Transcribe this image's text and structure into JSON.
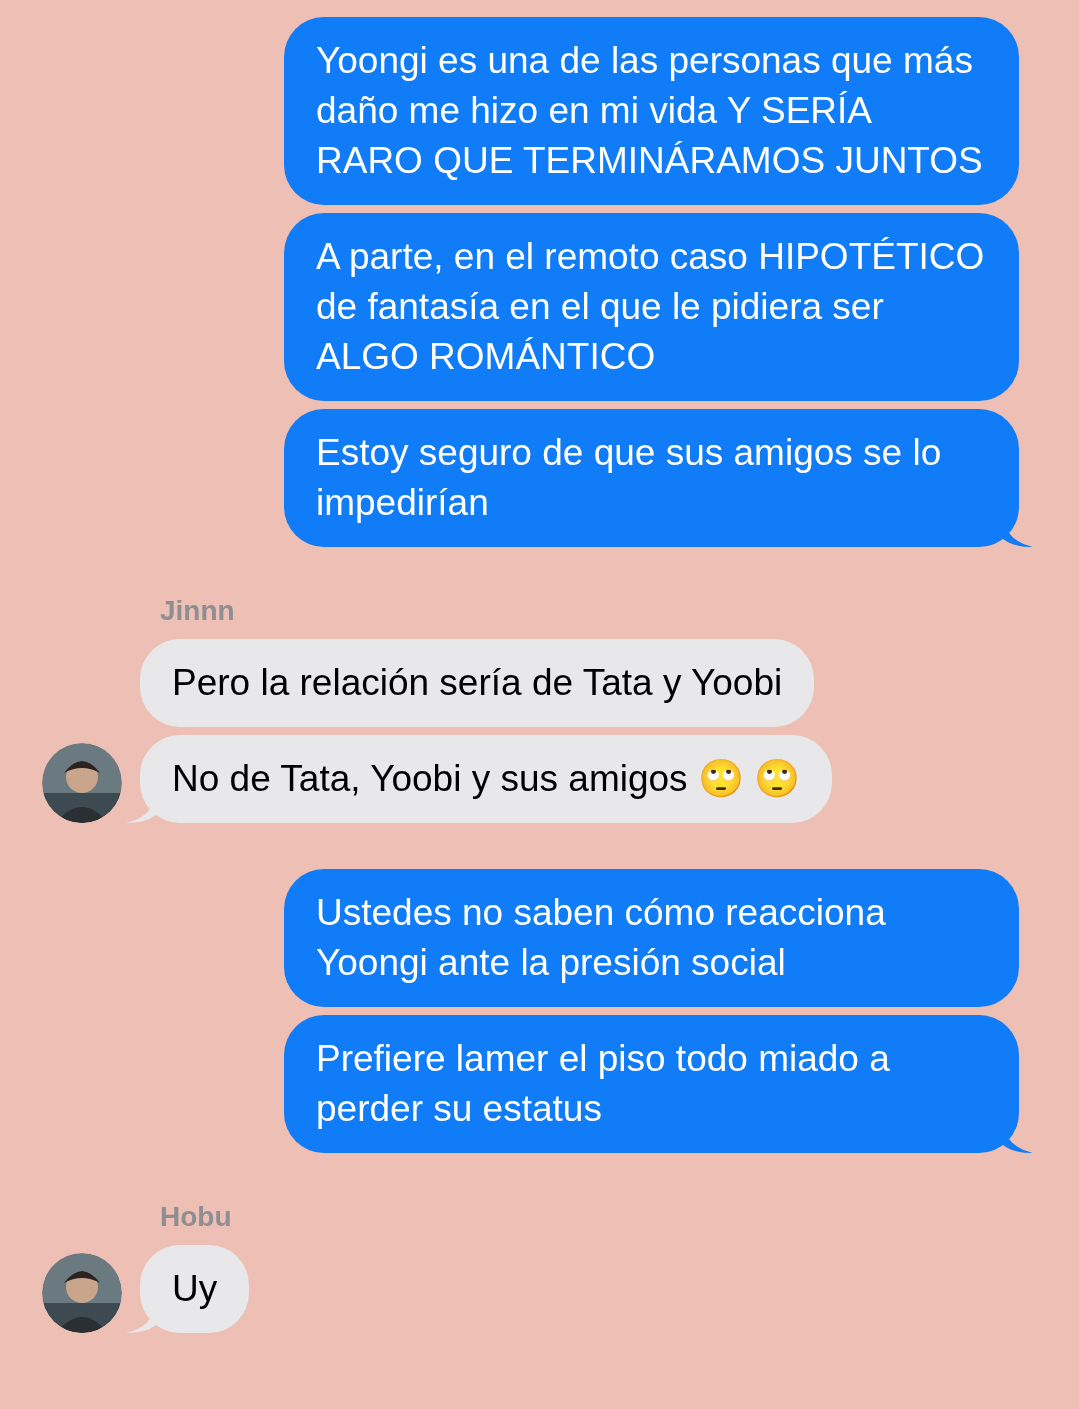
{
  "groups": [
    {
      "kind": "outgoing",
      "messages": [
        "Yoongi es una de las personas que más daño me hizo en mi vida Y SERÍA RARO QUE TERMINÁRAMOS JUNTOS",
        "A parte, en el remoto caso HIPOTÉTICO de fantasía en el que le pidiera ser ALGO ROMÁNTICO",
        "Estoy seguro de que sus amigos se lo impedirían"
      ]
    },
    {
      "kind": "incoming",
      "sender": "Jinnn",
      "messages": [
        "Pero la relación sería de Tata y Yoobi",
        "No de Tata, Yoobi y sus amigos 🙄 🙄"
      ]
    },
    {
      "kind": "outgoing",
      "messages": [
        "Ustedes no saben cómo reacciona Yoongi ante la presión social",
        "Prefiere lamer el piso todo miado a perder su estatus"
      ]
    },
    {
      "kind": "incoming",
      "sender": "Hobu",
      "messages": [
        "Uy"
      ]
    }
  ]
}
